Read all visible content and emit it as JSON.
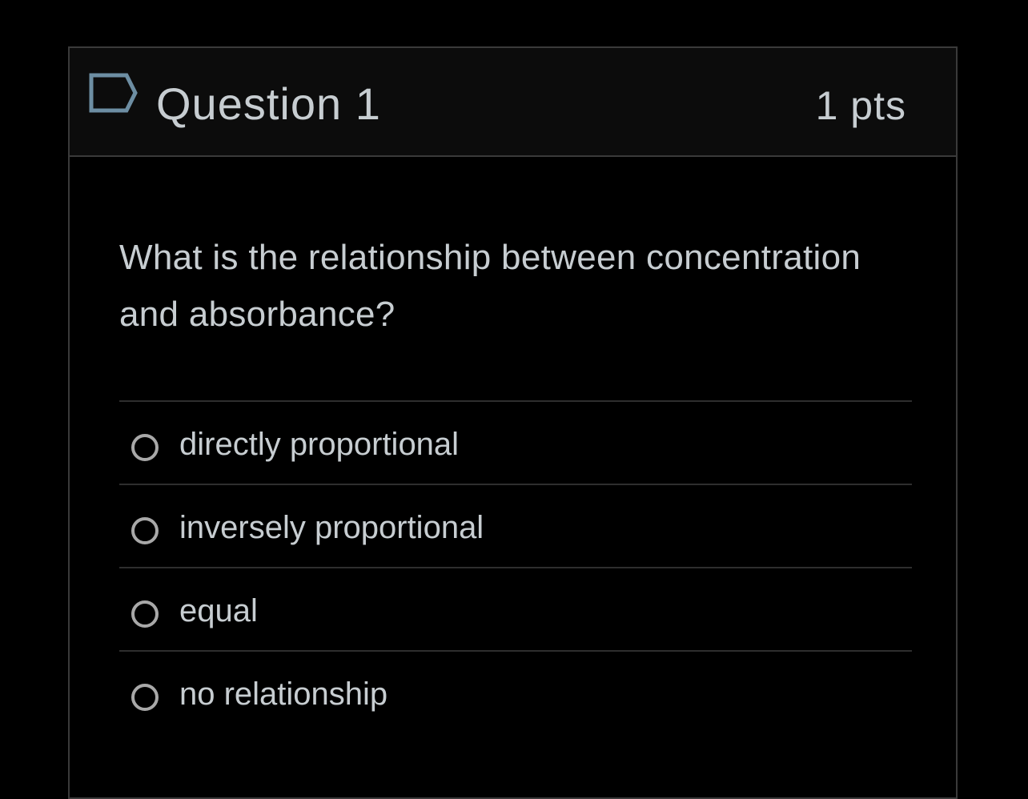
{
  "question": {
    "title": "Question 1",
    "points": "1 pts",
    "flag_icon": "flag-icon",
    "text": "What is the relationship between concentration and absorbance?"
  },
  "answers": [
    {
      "label": "directly proportional",
      "selected": false
    },
    {
      "label": "inversely proportional",
      "selected": false
    },
    {
      "label": "equal",
      "selected": false
    },
    {
      "label": "no relationship",
      "selected": false
    }
  ],
  "colors": {
    "background": "#000000",
    "header_background": "#0c0c0c",
    "text": "#c7cdd1",
    "border": "#3a3a3a",
    "radio": "#a8a8a8",
    "flag": "#6d8ea3"
  }
}
